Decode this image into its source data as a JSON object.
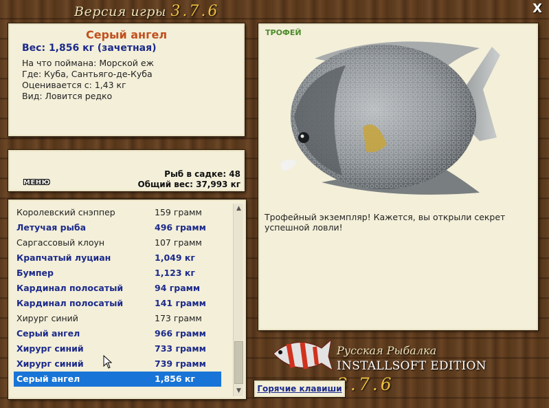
{
  "window": {
    "title_prefix": "Версия игры",
    "title_version": "3.7.6",
    "close_label": "X"
  },
  "info": {
    "fish_name": "Серый ангел",
    "weight": "Вес: 1,856 кг (зачетная)",
    "bait": "На что поймана: Морской еж",
    "place": "Где: Куба, Сантьяго-де-Куба",
    "valued": "Оценивается с: 1,43 кг",
    "kind": "Вид: Ловится редко"
  },
  "stats": {
    "menu_label": "МЕНЮ",
    "count_text": "Рыб в садке: 48",
    "total_text": "Общий вес: 37,993 кг"
  },
  "catch_list": [
    {
      "name": "Королевский снэппер",
      "weight": "159 грамм",
      "bold": false,
      "selected": false
    },
    {
      "name": "Летучая рыба",
      "weight": "496 грамм",
      "bold": true,
      "selected": false
    },
    {
      "name": "Саргассовый клоун",
      "weight": "107 грамм",
      "bold": false,
      "selected": false
    },
    {
      "name": "Крапчатый луциан",
      "weight": "1,049 кг",
      "bold": true,
      "selected": false
    },
    {
      "name": "Бумпер",
      "weight": "1,123 кг",
      "bold": true,
      "selected": false
    },
    {
      "name": "Кардинал полосатый",
      "weight": "94 грамм",
      "bold": true,
      "selected": false
    },
    {
      "name": "Кардинал полосатый",
      "weight": "141 грамм",
      "bold": true,
      "selected": false
    },
    {
      "name": "Хирург синий",
      "weight": "173 грамм",
      "bold": false,
      "selected": false
    },
    {
      "name": "Серый ангел",
      "weight": "966 грамм",
      "bold": true,
      "selected": false
    },
    {
      "name": "Хирург синий",
      "weight": "733 грамм",
      "bold": true,
      "selected": false
    },
    {
      "name": "Хирург синий",
      "weight": "739 грамм",
      "bold": true,
      "selected": false
    },
    {
      "name": "Серый ангел",
      "weight": "1,856 кг",
      "bold": true,
      "selected": true
    }
  ],
  "picture": {
    "badge": "ТРОФЕЙ",
    "description": "Трофейный экземпляр! Кажется, вы открыли секрет успешной ловли!"
  },
  "logo": {
    "brand": "Русская Рыбалка",
    "edition": "INSTALLSOFT EDITION",
    "version": "3.7.6"
  },
  "hotkeys": {
    "label": "Горячие клавиши"
  },
  "colors": {
    "accent_name": "#c0501e",
    "bold_text": "#1c2a8a",
    "selection": "#1874d6",
    "trophy": "#4e8a2c",
    "version": "#f0c040"
  },
  "icons": [
    "close-icon",
    "scroll-up-arrow-icon",
    "scroll-down-arrow-icon",
    "gray-angelfish-image",
    "logo-fish-icon",
    "mouse-cursor-icon"
  ]
}
